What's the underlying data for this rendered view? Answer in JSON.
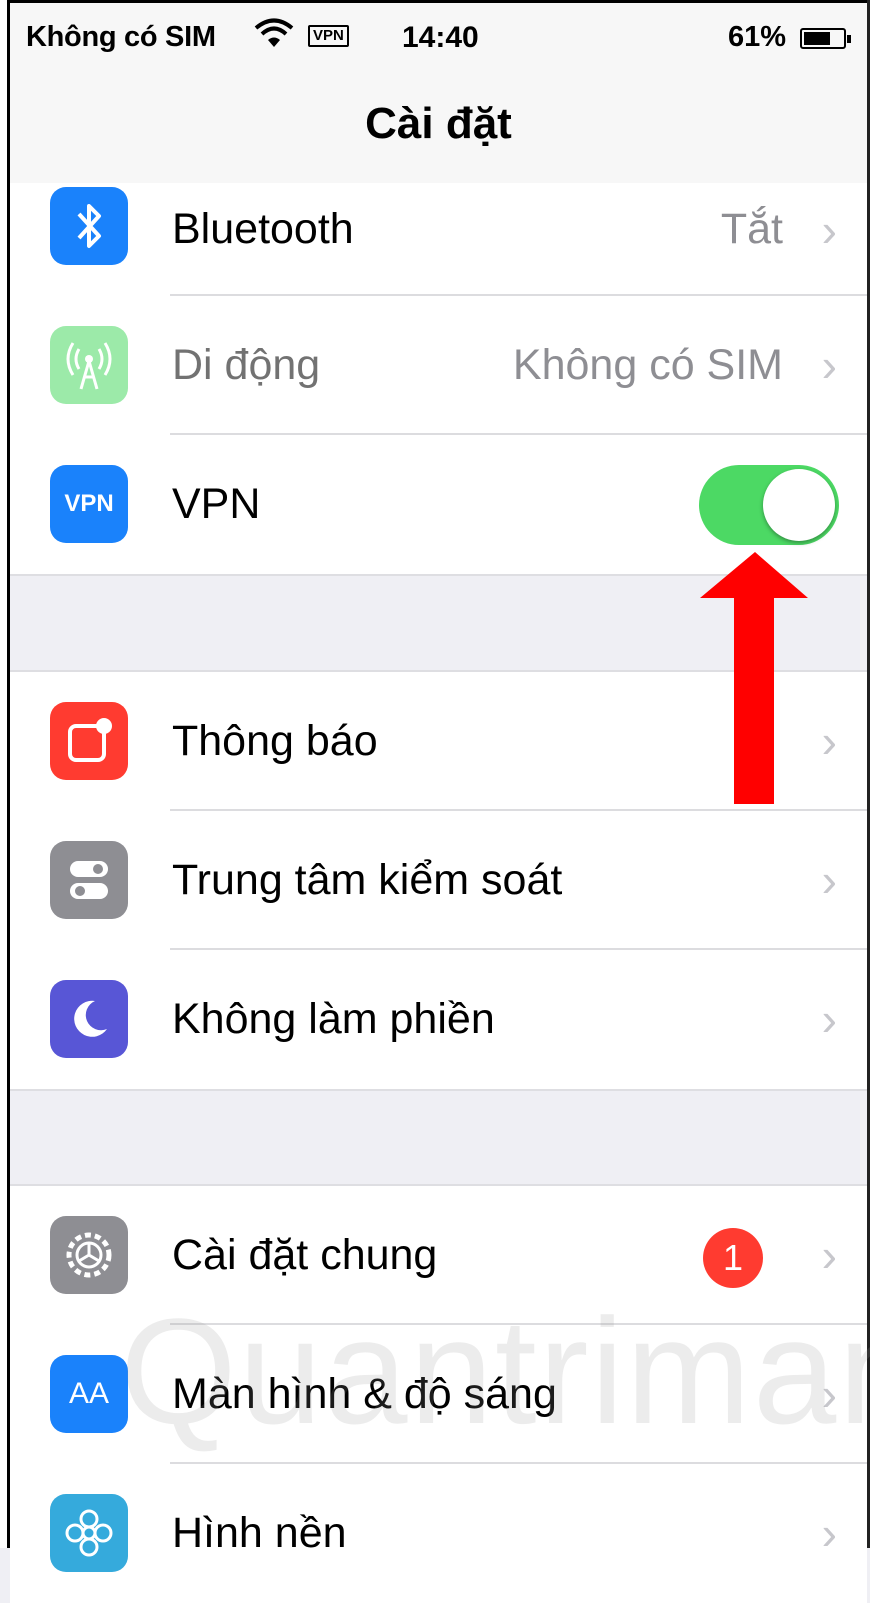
{
  "status_bar": {
    "carrier": "Không có SIM",
    "vpn_indicator": "VPN",
    "time": "14:40",
    "battery_percent": "61%",
    "battery_level": 0.61
  },
  "nav": {
    "title": "Cài đặt"
  },
  "group1": [
    {
      "label": "Bluetooth",
      "value": "Tắt",
      "icon": "bluetooth-icon",
      "color": "#1a82fb"
    },
    {
      "label": "Di động",
      "value": "Không có SIM",
      "icon": "cellular-antenna-icon",
      "color": "#4cd964"
    },
    {
      "label": "VPN",
      "icon_text": "VPN",
      "icon": "vpn-icon",
      "color": "#1a82fb",
      "toggle_on": true
    }
  ],
  "group2": [
    {
      "label": "Thông báo",
      "icon": "notifications-icon",
      "color": "#ff3b30"
    },
    {
      "label": "Trung tâm kiểm soát",
      "icon": "control-center-icon",
      "color": "#8e8e93"
    },
    {
      "label": "Không làm phiền",
      "icon": "moon-icon",
      "color": "#5856d6"
    }
  ],
  "group3": [
    {
      "label": "Cài đặt chung",
      "badge": "1",
      "icon": "gear-icon",
      "color": "#8e8e93"
    },
    {
      "label": "Màn hình & độ sáng",
      "icon_text": "AA",
      "icon": "display-brightness-icon",
      "color": "#1a82fb"
    },
    {
      "label": "Hình nền",
      "icon": "wallpaper-flower-icon",
      "color": "#35aadc"
    }
  ],
  "annotation": {
    "arrow_color": "#ff0000"
  },
  "watermark": "Quantrimang"
}
